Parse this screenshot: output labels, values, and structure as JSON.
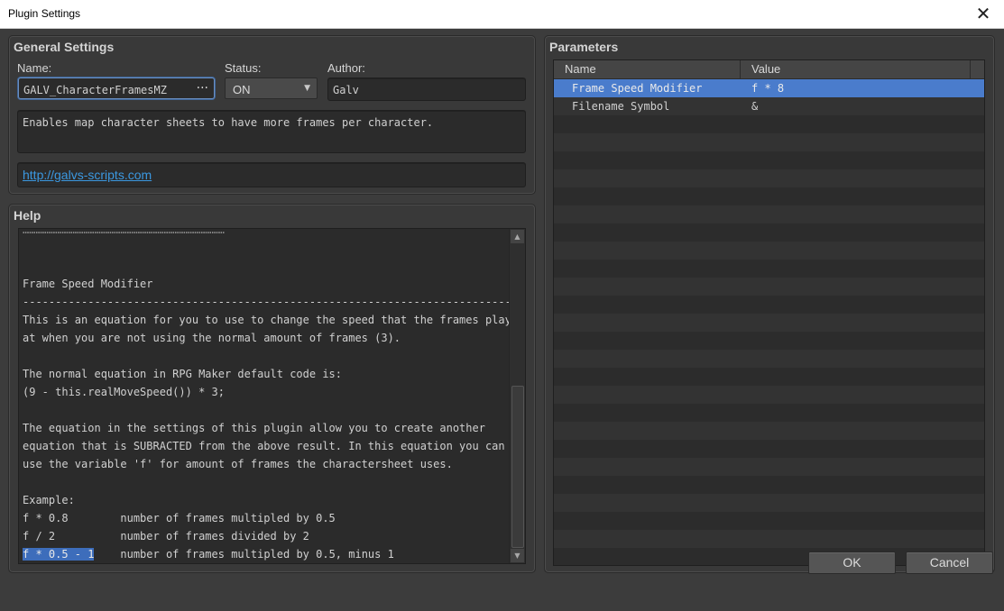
{
  "window": {
    "title": "Plugin Settings",
    "close_glyph": "✕"
  },
  "general": {
    "title": "General Settings",
    "name_label": "Name:",
    "name_value": "GALV_CharacterFramesMZ",
    "name_button": "···",
    "status_label": "Status:",
    "status_value": "ON",
    "author_label": "Author:",
    "author_value": "Galv",
    "description": "Enables map character sheets to have more frames per character.",
    "url": "http://galvs-scripts.com"
  },
  "help": {
    "title": "Help",
    "lines": [
      "",
      "",
      "",
      "Frame Speed Modifier",
      "-----------------------------------------------------------------------------",
      "This is an equation for you to use to change the speed that the frames play",
      "at when you are not using the normal amount of frames (3).",
      "",
      "The normal equation in RPG Maker default code is:",
      "(9 - this.realMoveSpeed()) * 3;",
      "",
      "The equation in the settings of this plugin allow you to create another",
      "equation that is SUBRACTED from the above result. In this equation you can",
      "use the variable 'f' for amount of frames the charactersheet uses.",
      "",
      "Example:",
      "f * 0.8        number of frames multipled by 0.5",
      "f / 2          number of frames divided by 2"
    ],
    "last_line_highlight": "f * 0.5 - 1",
    "last_line_rest": "    number of frames multipled by 0.5, minus 1"
  },
  "parameters": {
    "title": "Parameters",
    "col_name": "Name",
    "col_value": "Value",
    "rows": [
      {
        "name": "Frame Speed Modifier",
        "value": "f * 8"
      },
      {
        "name": "Filename Symbol",
        "value": "&"
      }
    ]
  },
  "buttons": {
    "ok": "OK",
    "cancel": "Cancel"
  },
  "colors": {
    "accent": "#4a7ccc",
    "link": "#3b98e0",
    "panel": "#393939"
  }
}
